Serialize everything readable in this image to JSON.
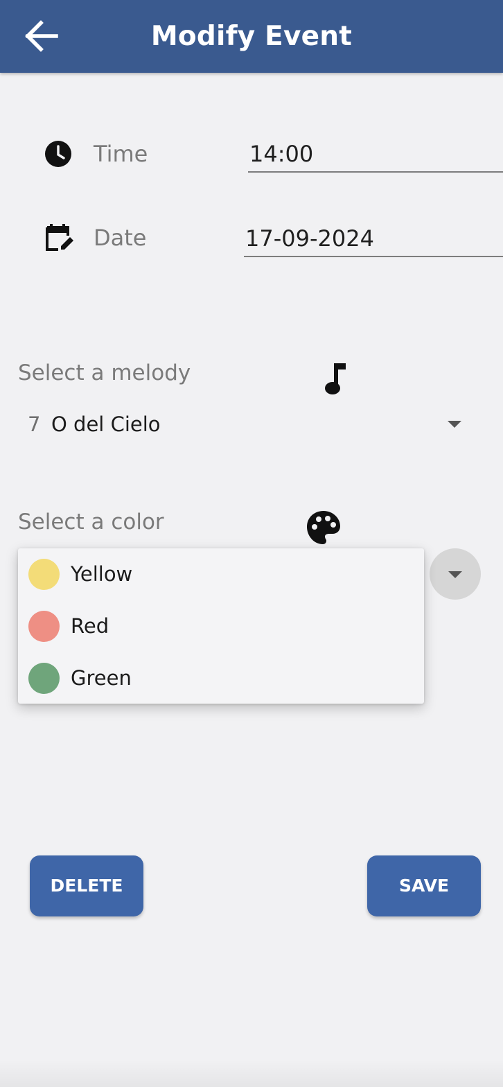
{
  "appbar": {
    "title": "Modify Event",
    "background": "#3a5a8f",
    "back_icon": "arrow-left-icon"
  },
  "time": {
    "icon": "clock-icon",
    "label": "Time",
    "value": "14:00"
  },
  "date": {
    "icon": "calendar-edit-icon",
    "label": "Date",
    "value": "17-09-2024"
  },
  "melody": {
    "label": "Select a melody",
    "icon": "music-note-icon",
    "selected_number": "7",
    "selected_name": "O del Cielo"
  },
  "color": {
    "label": "Select a color",
    "icon": "palette-icon",
    "options": [
      {
        "label": "Yellow",
        "swatch": "#f3dc78"
      },
      {
        "label": "Red",
        "swatch": "#ee8f84"
      },
      {
        "label": "Green",
        "swatch": "#6fa57b"
      }
    ]
  },
  "actions": {
    "delete_label": "DELETE",
    "save_label": "SAVE",
    "button_color": "#3f66a8"
  }
}
